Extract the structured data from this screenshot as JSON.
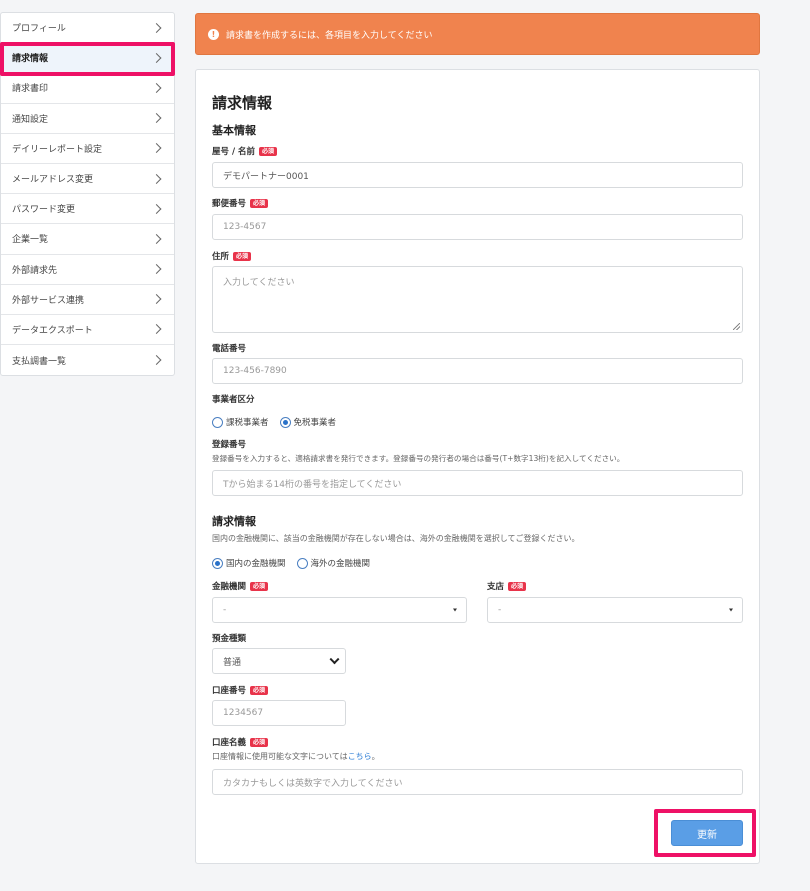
{
  "sidebar": {
    "items": [
      {
        "label": "プロフィール"
      },
      {
        "label": "請求情報"
      },
      {
        "label": "請求書印"
      },
      {
        "label": "通知設定"
      },
      {
        "label": "デイリーレポート設定"
      },
      {
        "label": "メールアドレス変更"
      },
      {
        "label": "パスワード変更"
      },
      {
        "label": "企業一覧"
      },
      {
        "label": "外部請求先"
      },
      {
        "label": "外部サービス連携"
      },
      {
        "label": "データエクスポート"
      },
      {
        "label": "支払調書一覧"
      }
    ]
  },
  "alert": {
    "text": "請求書を作成するには、各項目を入力してください",
    "icon": "!"
  },
  "form": {
    "title": "請求情報",
    "basic_section": "基本情報",
    "required_badge": "必須",
    "name_label": "屋号 / 名前",
    "name_value": "デモパートナー0001",
    "postal_label": "郵便番号",
    "postal_placeholder": "123-4567",
    "address_label": "住所",
    "address_placeholder": "入力してください",
    "phone_label": "電話番号",
    "phone_placeholder": "123-456-7890",
    "business_type_label": "事業者区分",
    "business_type_options": [
      "課税事業者",
      "免税事業者"
    ],
    "business_type_selected": "免税事業者",
    "registration_label": "登録番号",
    "registration_help": "登録番号を入力すると、適格請求書を発行できます。登録番号の発行者の場合は番号(T+数字13桁)を記入してください。",
    "registration_placeholder": "Tから始まる14桁の番号を指定してください",
    "billing_section": "請求情報",
    "billing_help": "国内の金融機関に、該当の金融機関が存在しない場合は、海外の金融機関を選択してご登録ください。",
    "bank_scope_options": [
      "国内の金融機関",
      "海外の金融機関"
    ],
    "bank_scope_selected": "国内の金融機関",
    "bank_label": "金融機関",
    "bank_value": "-",
    "branch_label": "支店",
    "branch_value": "-",
    "account_type_label": "預金種類",
    "account_type_value": "普通",
    "account_number_label": "口座番号",
    "account_number_placeholder": "1234567",
    "account_name_label": "口座名義",
    "account_name_help_prefix": "口座情報に使用可能な文字については",
    "account_name_help_link": "こちら",
    "account_name_help_suffix": "。",
    "account_name_placeholder": "カタカナもしくは英数字で入力してください",
    "update_button": "更新"
  },
  "colors": {
    "alert": "#f0834e",
    "highlight": "#ee1166",
    "primary": "#5a9ee6",
    "required": "#e8334a"
  }
}
